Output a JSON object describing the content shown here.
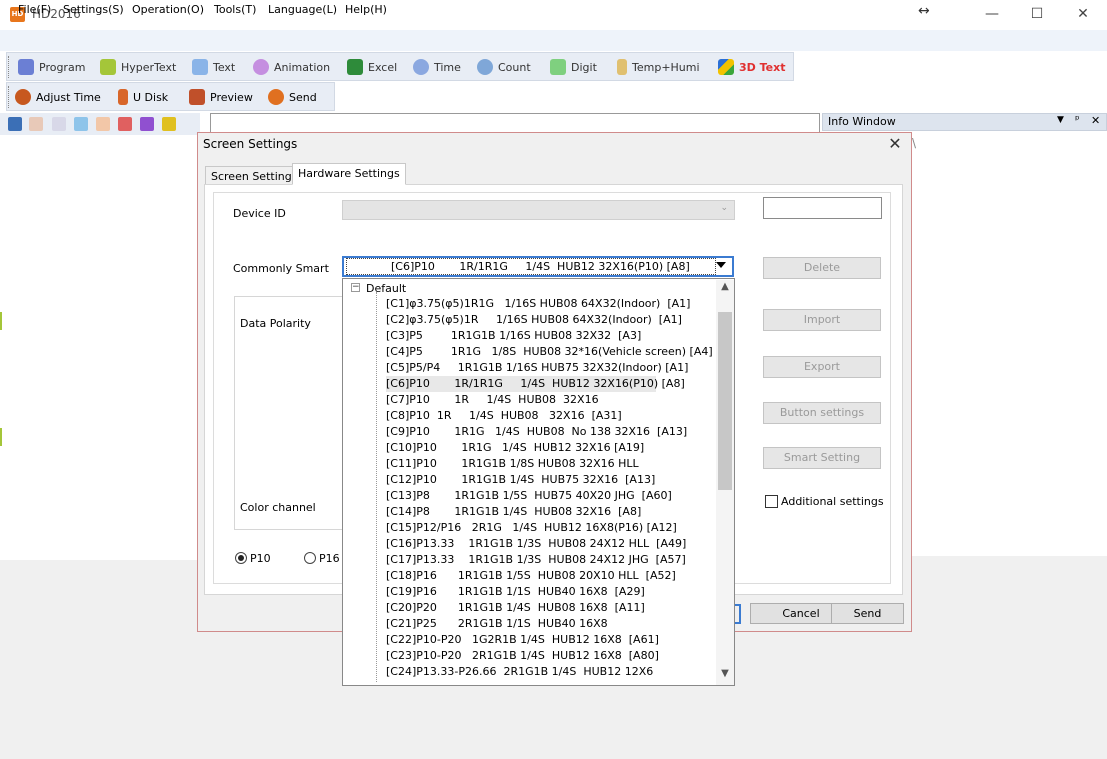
{
  "window": {
    "title": "HD2016",
    "logo_text": "HD",
    "resize_glyph": "↔",
    "min": "—",
    "max": "☐",
    "close": "✕"
  },
  "menu": [
    "File(F)",
    "Settings(S)",
    "Operation(O)",
    "Tools(T)",
    "Language(L)",
    "Help(H)"
  ],
  "toolbar1": [
    {
      "label": "Program",
      "icon": "program-icon",
      "color": "#6b7fd4"
    },
    {
      "label": "HyperText",
      "icon": "hypertext-icon",
      "color": "#a4c639"
    },
    {
      "label": "Text",
      "icon": "text-icon",
      "color": "#8ab4e8"
    },
    {
      "label": "Animation",
      "icon": "animation-icon",
      "color": "#c58fe0"
    },
    {
      "label": "Excel",
      "icon": "excel-icon",
      "color": "#2e8b3a"
    },
    {
      "label": "Time",
      "icon": "clock-icon",
      "color": "#8ba8e0"
    },
    {
      "label": "Count",
      "icon": "counter-icon",
      "color": "#7fa7d8"
    },
    {
      "label": "Digit",
      "icon": "digit-icon",
      "color": "#7fd07f"
    },
    {
      "label": "Temp+Humi",
      "icon": "thermometer-icon",
      "color": "#e0c070"
    },
    {
      "label": "3D Text",
      "icon": "cube-icon",
      "color": "#e03030"
    }
  ],
  "toolbar2": [
    {
      "label": "Adjust Time",
      "icon": "adjust-time-icon",
      "color": "#c7581f"
    },
    {
      "label": "U Disk",
      "icon": "usb-disk-icon",
      "color": "#d8662a"
    },
    {
      "label": "Preview",
      "icon": "camera-icon",
      "color": "#c0502a"
    },
    {
      "label": "Send",
      "icon": "send-arrow-icon",
      "color": "#e07020"
    }
  ],
  "info_window": {
    "title": "Info Window",
    "dropdown_glyph": "▼",
    "pin_glyph": "ᵖ",
    "close_glyph": "✕",
    "tab_glyph": "\\"
  },
  "dialog": {
    "title": "Screen Settings",
    "close": "✕",
    "tabs": [
      "Screen Settings",
      "Hardware Settings"
    ],
    "device_id_label": "Device ID",
    "device_id_value": "",
    "commonly_smart_label": "Commonly Smart",
    "commonly_smart_value": "[C6]P10       1R/1R1G     1/4S  HUB12 32X16(P10) [A8]",
    "data_polarity_label": "Data Polarity",
    "color_channel_label": "Color channel",
    "radio_p10": "P10",
    "radio_p16": "P16",
    "buttons": {
      "delete": "Delete",
      "import": "Import",
      "export": "Export",
      "button_settings": "Button settings",
      "smart_setting": "Smart Setting",
      "cancel": "Cancel",
      "send": "Send"
    },
    "additional_settings": "Additional settings"
  },
  "dropdown": {
    "root": "Default",
    "expander": "−",
    "items": [
      "[C1]φ3.75(φ5)1R1G   1/16S HUB08 64X32(Indoor)  [A1]",
      "[C2]φ3.75(φ5)1R     1/16S HUB08 64X32(Indoor)  [A1]",
      "[C3]P5        1R1G1B 1/16S HUB08 32X32  [A3]",
      "[C4]P5        1R1G   1/8S  HUB08 32*16(Vehicle screen) [A4]",
      "[C5]P5/P4     1R1G1B 1/16S HUB75 32X32(Indoor) [A1]",
      "[C6]P10       1R/1R1G     1/4S  HUB12 32X16(P10) [A8]",
      "[C7]P10       1R     1/4S  HUB08  32X16",
      "[C8]P10  1R     1/4S  HUB08   32X16  [A31]",
      "[C9]P10       1R1G   1/4S  HUB08  No 138 32X16  [A13]",
      "[C10]P10       1R1G   1/4S  HUB12 32X16 [A19]",
      "[C11]P10       1R1G1B 1/8S HUB08 32X16 HLL",
      "[C12]P10       1R1G1B 1/4S  HUB75 32X16  [A13]",
      "[C13]P8       1R1G1B 1/5S  HUB75 40X20 JHG  [A60]",
      "[C14]P8       1R1G1B 1/4S  HUB08 32X16  [A8]",
      "[C15]P12/P16   2R1G   1/4S  HUB12 16X8(P16) [A12]",
      "[C16]P13.33    1R1G1B 1/3S  HUB08 24X12 HLL  [A49]",
      "[C17]P13.33    1R1G1B 1/3S  HUB08 24X12 JHG  [A57]",
      "[C18]P16      1R1G1B 1/5S  HUB08 20X10 HLL  [A52]",
      "[C19]P16      1R1G1B 1/1S  HUB40 16X8  [A29]",
      "[C20]P20      1R1G1B 1/4S  HUB08 16X8  [A11]",
      "[C21]P25      2R1G1B 1/1S  HUB40 16X8",
      "[C22]P10-P20   1G2R1B 1/4S  HUB12 16X8  [A61]",
      "[C23]P10-P20   2R1G1B 1/4S  HUB12 16X8  [A80]",
      "[C24]P13.33-P26.66  2R1G1B 1/4S  HUB12 12X6"
    ],
    "scroll_up": "▲",
    "scroll_down": "▼"
  }
}
